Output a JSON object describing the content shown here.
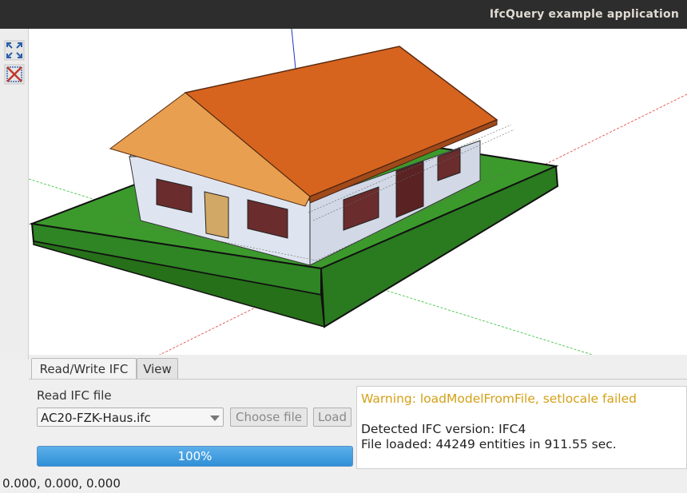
{
  "window": {
    "title": "IfcQuery example application"
  },
  "toolbar": {
    "zoom_icon": "zoom-to-fit-icon",
    "clear_icon": "clear-selection-icon"
  },
  "tabs": [
    {
      "label": "Read/Write IFC",
      "active": true
    },
    {
      "label": "View",
      "active": false
    }
  ],
  "read_panel": {
    "label": "Read IFC file",
    "file_select_value": "AC20-FZK-Haus.ifc",
    "choose_file_label": "Choose file",
    "load_label": "Load",
    "progress_text": "100%",
    "progress_value": 1.0
  },
  "log": {
    "warning": "Warning: loadModelFromFile, setlocale failed",
    "version": "Detected IFC version: IFC4",
    "loaded": "File loaded: 44249 entities in 911.55 sec."
  },
  "colors": {
    "warning_text": "#d4a017",
    "progress": "#3a9be0",
    "roof": "#d6641f",
    "ground": "#3c9a2c"
  },
  "status": {
    "coordinates": "0.000, 0.000, 0.000"
  }
}
